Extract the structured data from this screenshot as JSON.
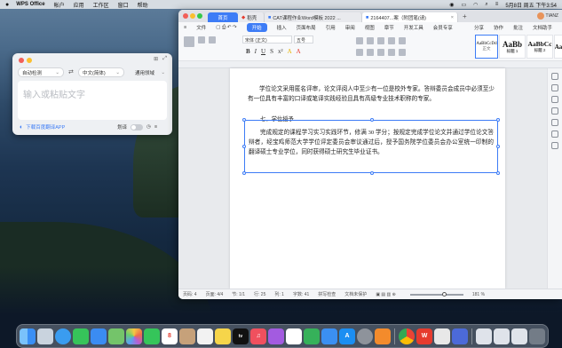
{
  "menubar": {
    "app_name": "WPS Office",
    "items": [
      "帐户",
      "应用",
      "工作区",
      "窗口",
      "帮助"
    ],
    "clock": "5月8日 周五 下午3:54"
  },
  "translator": {
    "source_lang": "自动检测",
    "arrow": "⇄",
    "target_lang": "中文(简体)",
    "domain": "通用领域",
    "placeholder": "输入或粘贴文字",
    "download_link": "下载百度翻译APP",
    "translate_label": "划译"
  },
  "wps": {
    "tabs": [
      {
        "label": "首页"
      },
      {
        "label": "稻壳"
      },
      {
        "label": "CAT课程作业Word模板 2022 ..."
      },
      {
        "label": "2164407...案（附团笔(请)"
      }
    ],
    "user": "TIANZ",
    "menu": [
      "文件",
      "开始",
      "插入",
      "页面布局",
      "引用",
      "审阅",
      "视图",
      "章节",
      "开发工具",
      "会员专享"
    ],
    "menu_active": "开始",
    "menu_right": [
      "分享",
      "协作",
      "批注",
      "文档助手"
    ],
    "font_name": "宋体 (正文)",
    "font_size": "五号",
    "styles": [
      {
        "sample": "AaBbCcDd",
        "name": "正文"
      },
      {
        "sample": "AaBb",
        "name": "标题 1"
      },
      {
        "sample": "AaBbCc",
        "name": "标题 2"
      },
      {
        "sample": "Aa",
        "name": "标题 3"
      }
    ],
    "doc": {
      "para1": "学位论文采用匿名评审，论文评阅人中至少有一位是校外专家。答辩委员会成员中必须至少有一位具有丰富的口译或笔译实践经验且具有高级专业技术职称的专家。",
      "heading": "七、学位授予",
      "para2": "完成规定的课程学习实习实践环节，修满 30 学分；按规定完成学位论文并通过学位论文答辩者，经宝鸡师范大学学位评定委员会审议通过后，授予国务院学位委员会办公室统一印制的翻译硕士专业学位，同时获得硕士研究生毕业证书。"
    },
    "status": {
      "page": "页码: 4",
      "pages": "页面: 4/4",
      "section": "节: 1/1",
      "row": "行: 25",
      "col": "列: 1",
      "words": "字数: 41",
      "spell": "拼写检查",
      "protect": "文档未保护",
      "zoom": "181 %"
    }
  },
  "dock": {
    "apps": [
      "Finder",
      "Launchpad",
      "Safari",
      "信息",
      "邮件",
      "地图",
      "照片",
      "FaceTime",
      "日历",
      "通讯录",
      "提醒事项",
      "备忘录",
      "Apple TV",
      "音乐",
      "播客",
      "Numbers",
      "Keynote",
      "App Store",
      "系统偏好设置",
      "Pages",
      "Chrome",
      "WPS",
      "PDF",
      "Xcode",
      "文稿",
      "下载",
      "访达",
      "废纸篓"
    ],
    "colors": {
      "finder": "#3a8ff5",
      "wps": "#e63b2e",
      "chrome": "#f4c20d",
      "tv": "#111111"
    }
  }
}
